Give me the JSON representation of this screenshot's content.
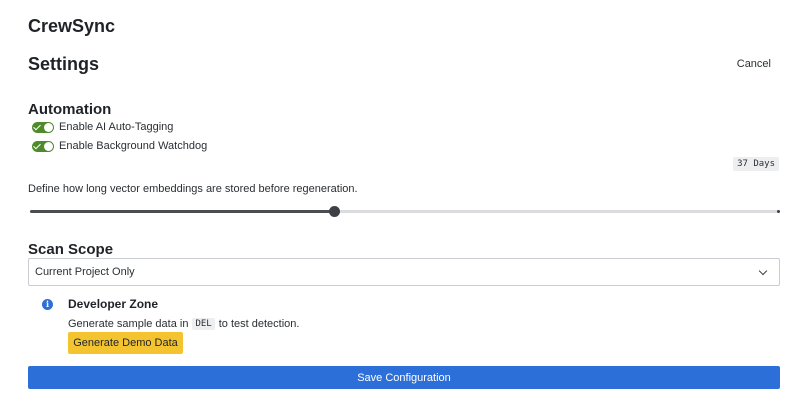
{
  "app": {
    "title": "CrewSync"
  },
  "header": {
    "title": "Settings",
    "cancel_label": "Cancel"
  },
  "automation": {
    "heading": "Automation",
    "toggles": [
      {
        "label": "Enable AI Auto-Tagging",
        "on": true
      },
      {
        "label": "Enable Background Watchdog",
        "on": true
      }
    ],
    "retention": {
      "value_label": "37 Days",
      "description": "Define how long vector embeddings are stored before regeneration.",
      "slider_fraction": 0.405
    }
  },
  "scope": {
    "heading": "Scan Scope",
    "selected": "Current Project Only"
  },
  "developer": {
    "icon": "info-icon",
    "heading": "Developer Zone",
    "desc_before": "Generate sample data in",
    "desc_code": "DEL",
    "desc_after": "to test detection.",
    "button_label": "Generate Demo Data"
  },
  "footer": {
    "save_label": "Save Configuration"
  },
  "colors": {
    "toggle_on": "#4f8a2b",
    "demo_button": "#f4c430",
    "primary": "#2d6fd8",
    "info": "#2f6fd6"
  }
}
